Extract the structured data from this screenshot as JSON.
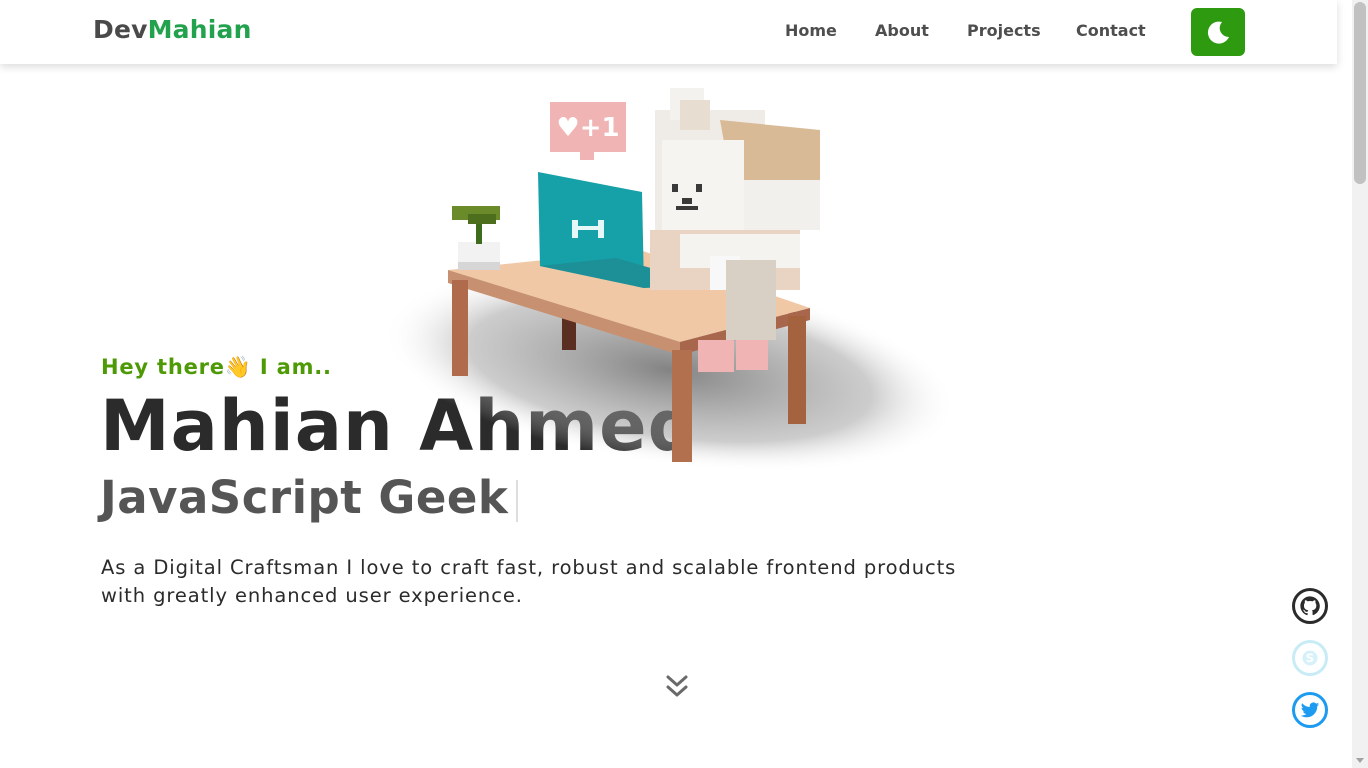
{
  "header": {
    "logo_part1": "Dev",
    "logo_part2": "Mahian",
    "nav": [
      {
        "label": "Home"
      },
      {
        "label": "About"
      },
      {
        "label": "Projects"
      },
      {
        "label": "Contact"
      }
    ],
    "theme_toggle_icon": "moon-icon"
  },
  "hero": {
    "greeting": "Hey there👋 I am..",
    "name": "Mahian Ahmed",
    "role": "JavaScript Geek",
    "bio": "As a Digital Craftsman I love to craft fast, robust and scalable frontend products with greatly enhanced user experience.",
    "illustration_sign": "♥+1",
    "scroll_icon": "chevrons-down-icon"
  },
  "social": [
    {
      "name": "github",
      "icon": "github-icon",
      "color": "#2b2b2b"
    },
    {
      "name": "skype",
      "icon": "skype-icon",
      "color": "#c8ecf6"
    },
    {
      "name": "twitter",
      "icon": "twitter-icon",
      "color": "#1d9bf0"
    }
  ],
  "colors": {
    "accent_green": "#23a24d",
    "button_green": "#2e9a10",
    "greeting_green": "#4e9a06"
  }
}
